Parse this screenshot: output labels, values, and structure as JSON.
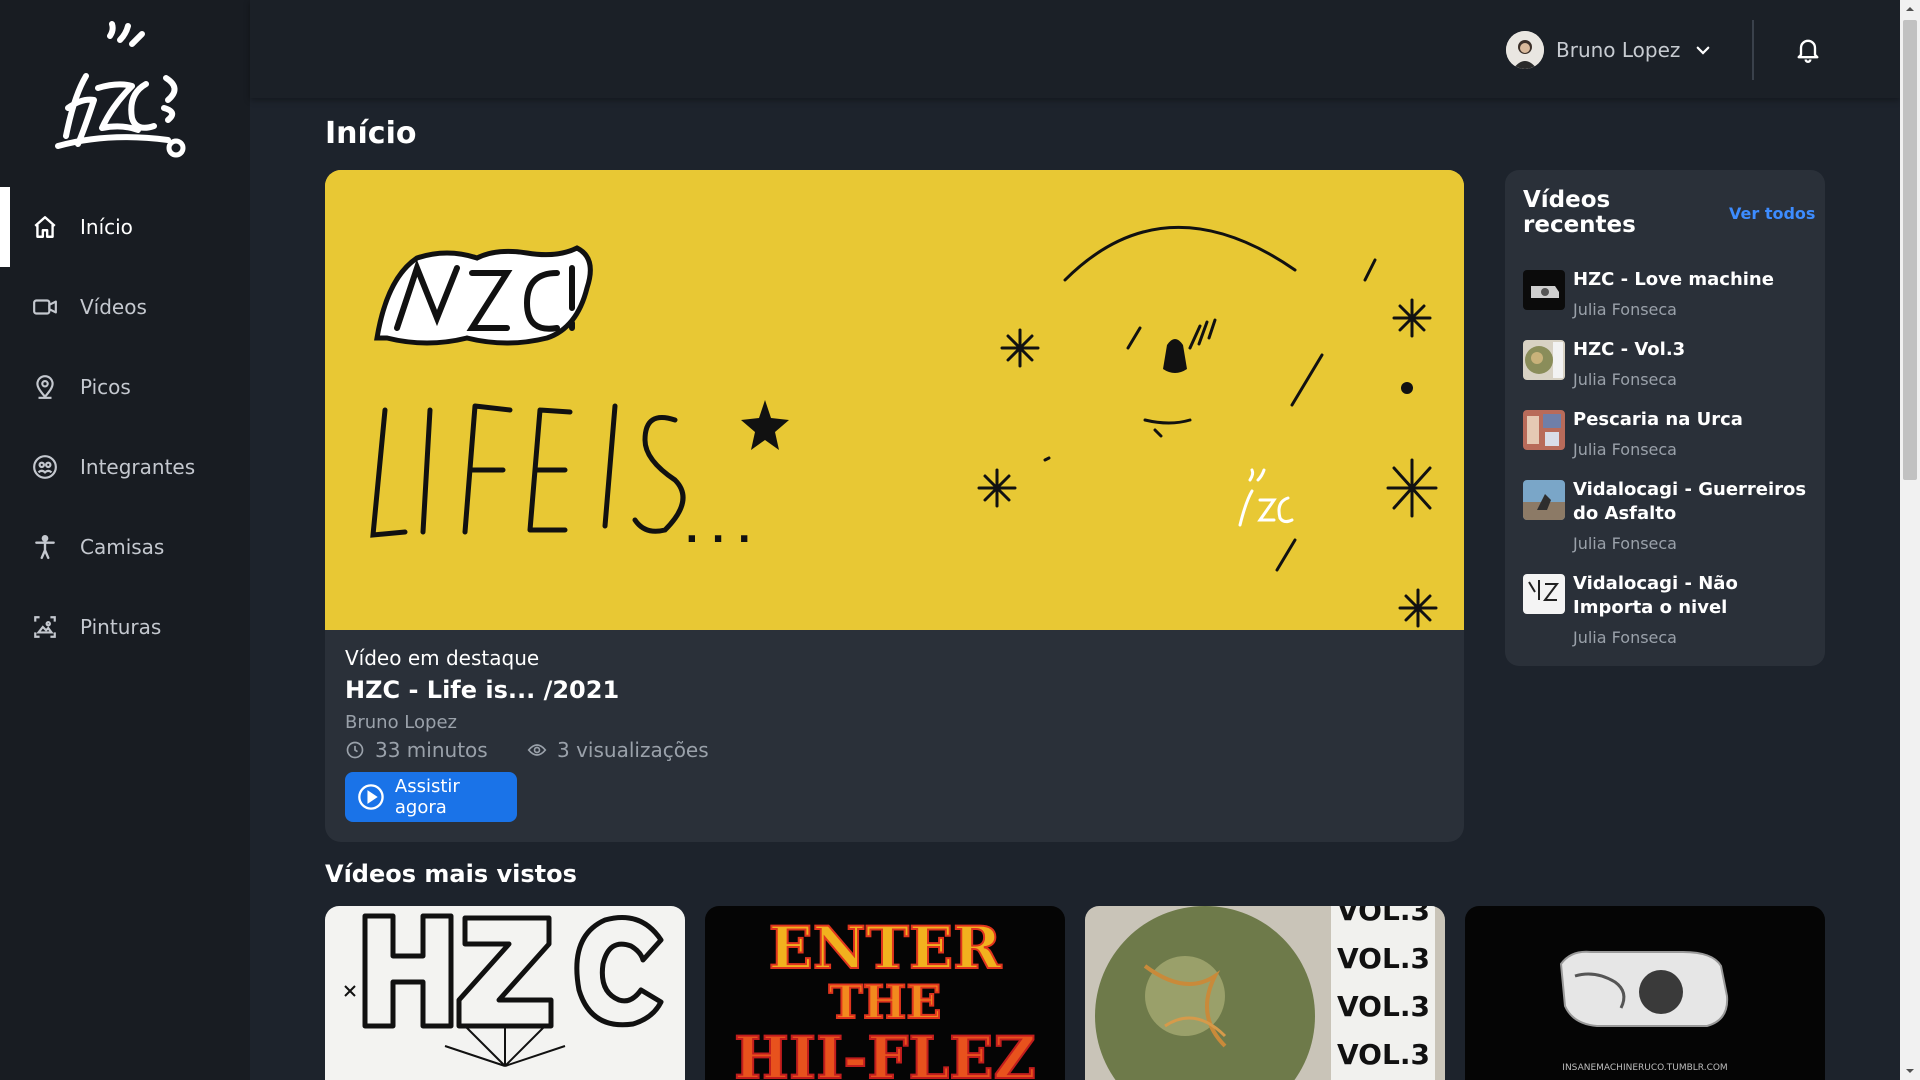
{
  "sidebar": {
    "logo_icon": "hzc-graffiti-logo",
    "items": [
      {
        "label": "Início",
        "icon": "home-icon",
        "active": true
      },
      {
        "label": "Vídeos",
        "icon": "video-camera-icon",
        "active": false
      },
      {
        "label": "Picos",
        "icon": "map-pin-icon",
        "active": false
      },
      {
        "label": "Integrantes",
        "icon": "group-icon",
        "active": false
      },
      {
        "label": "Camisas",
        "icon": "person-icon",
        "active": false
      },
      {
        "label": "Pinturas",
        "icon": "picture-icon",
        "active": false
      }
    ]
  },
  "header": {
    "user_name": "Bruno Lopez",
    "icons": [
      "avatar",
      "chevron-down-icon",
      "bell-icon"
    ]
  },
  "main": {
    "page_title": "Início",
    "featured": {
      "kicker": "Vídeo em destaque",
      "title": "HZC - Life is... /2021",
      "author": "Bruno Lopez",
      "duration": "33 minutos",
      "views": "3 visualizações",
      "watch_label": "Assistir agora",
      "art_text": "LIFE IS",
      "art_background": "#e8c834"
    },
    "recent": {
      "title": "Vídeos recentes",
      "see_all": "Ver todos",
      "items": [
        {
          "title": "HZC - Love machine",
          "author": "Julia Fonseca"
        },
        {
          "title": "HZC - Vol.3",
          "author": "Julia Fonseca"
        },
        {
          "title": "Pescaria na Urca",
          "author": "Julia Fonseca"
        },
        {
          "title": "Vidalocagi - Guerreiros do Asfalto",
          "author": "Julia Fonseca"
        },
        {
          "title": "Vidalocagi - Não Importa o nivel",
          "author": "Julia Fonseca"
        }
      ]
    },
    "most_viewed": {
      "title": "Vídeos mais vistos",
      "cards": [
        {
          "art_text": "HZC"
        },
        {
          "art_text": "ENTER THE HII-FLEZ"
        },
        {
          "art_text": "VOL.3"
        },
        {
          "art_text": "INSANEMACHINERUCO.TUMBLR.COM"
        }
      ]
    }
  },
  "colors": {
    "accent": "#1a73e8",
    "link": "#3d8cff",
    "sidebar_bg": "#181c22",
    "page_bg": "#1d232c",
    "card_bg": "#2a3039"
  }
}
